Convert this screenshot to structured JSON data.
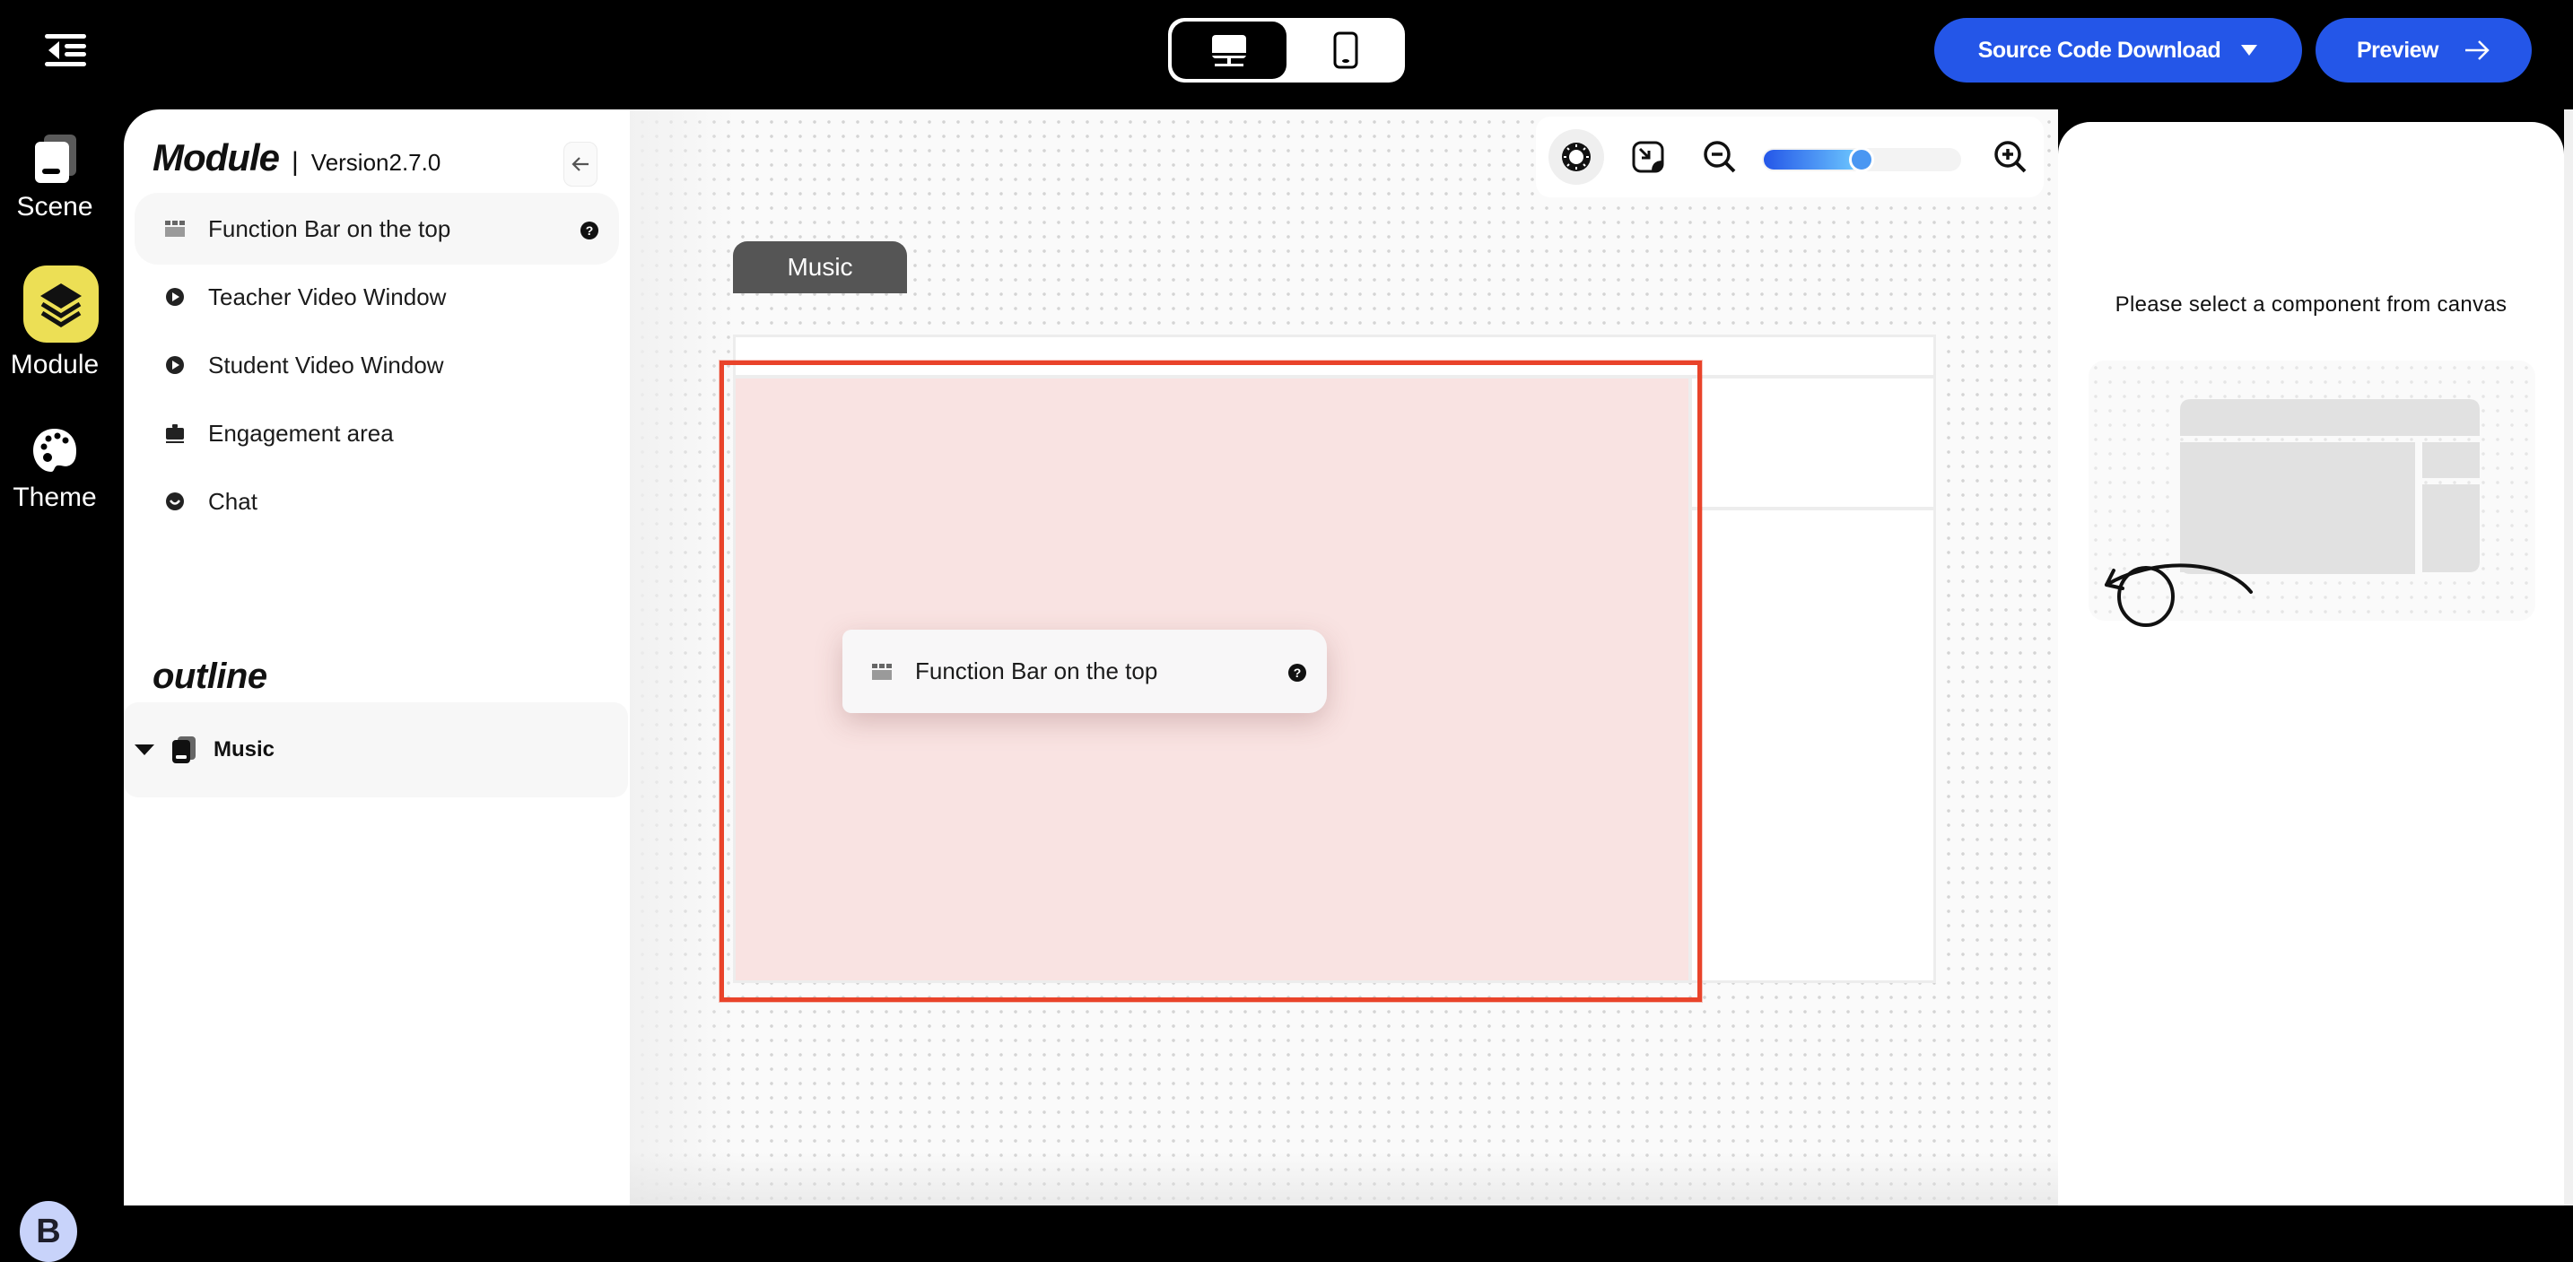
{
  "topbar": {
    "menu_icon": "collapse-menu-icon",
    "device_modes": [
      {
        "name": "desktop",
        "icon": "desktop-monitor-icon",
        "active": true
      },
      {
        "name": "mobile",
        "icon": "mobile-phone-icon",
        "active": false
      }
    ],
    "download_label": "Source Code Download",
    "preview_label": "Preview",
    "accent_color": "#2456E8"
  },
  "leftnav": {
    "items": [
      {
        "label": "Scene",
        "icon": "scene-icon",
        "active": false
      },
      {
        "label": "Module",
        "icon": "layers-icon",
        "active": true
      },
      {
        "label": "Theme",
        "icon": "palette-icon",
        "active": false
      }
    ],
    "active_color": "#ECDF55",
    "avatar_initial": "B"
  },
  "module_panel": {
    "title": "Module",
    "separator": "|",
    "version": "Version2.7.0",
    "items": [
      {
        "label": "Function Bar on the top",
        "icon": "function-bar-icon",
        "selected": true,
        "help": true
      },
      {
        "label": "Teacher Video Window",
        "icon": "play-circle-icon"
      },
      {
        "label": "Student Video Window",
        "icon": "play-circle-icon"
      },
      {
        "label": "Engagement area",
        "icon": "briefcase-icon"
      },
      {
        "label": "Chat",
        "icon": "chat-icon"
      }
    ],
    "outline_title": "outline",
    "outline_items": [
      {
        "label": "Music",
        "expanded": true,
        "icon": "scene-icon"
      }
    ]
  },
  "canvas": {
    "zoom_level": 0.5,
    "scene_tab": "Music",
    "drag_item": {
      "label": "Function Bar on the top",
      "help": true
    },
    "highlight_color": "#E9432A"
  },
  "right_panel": {
    "hint": "Please select a component from canvas"
  }
}
